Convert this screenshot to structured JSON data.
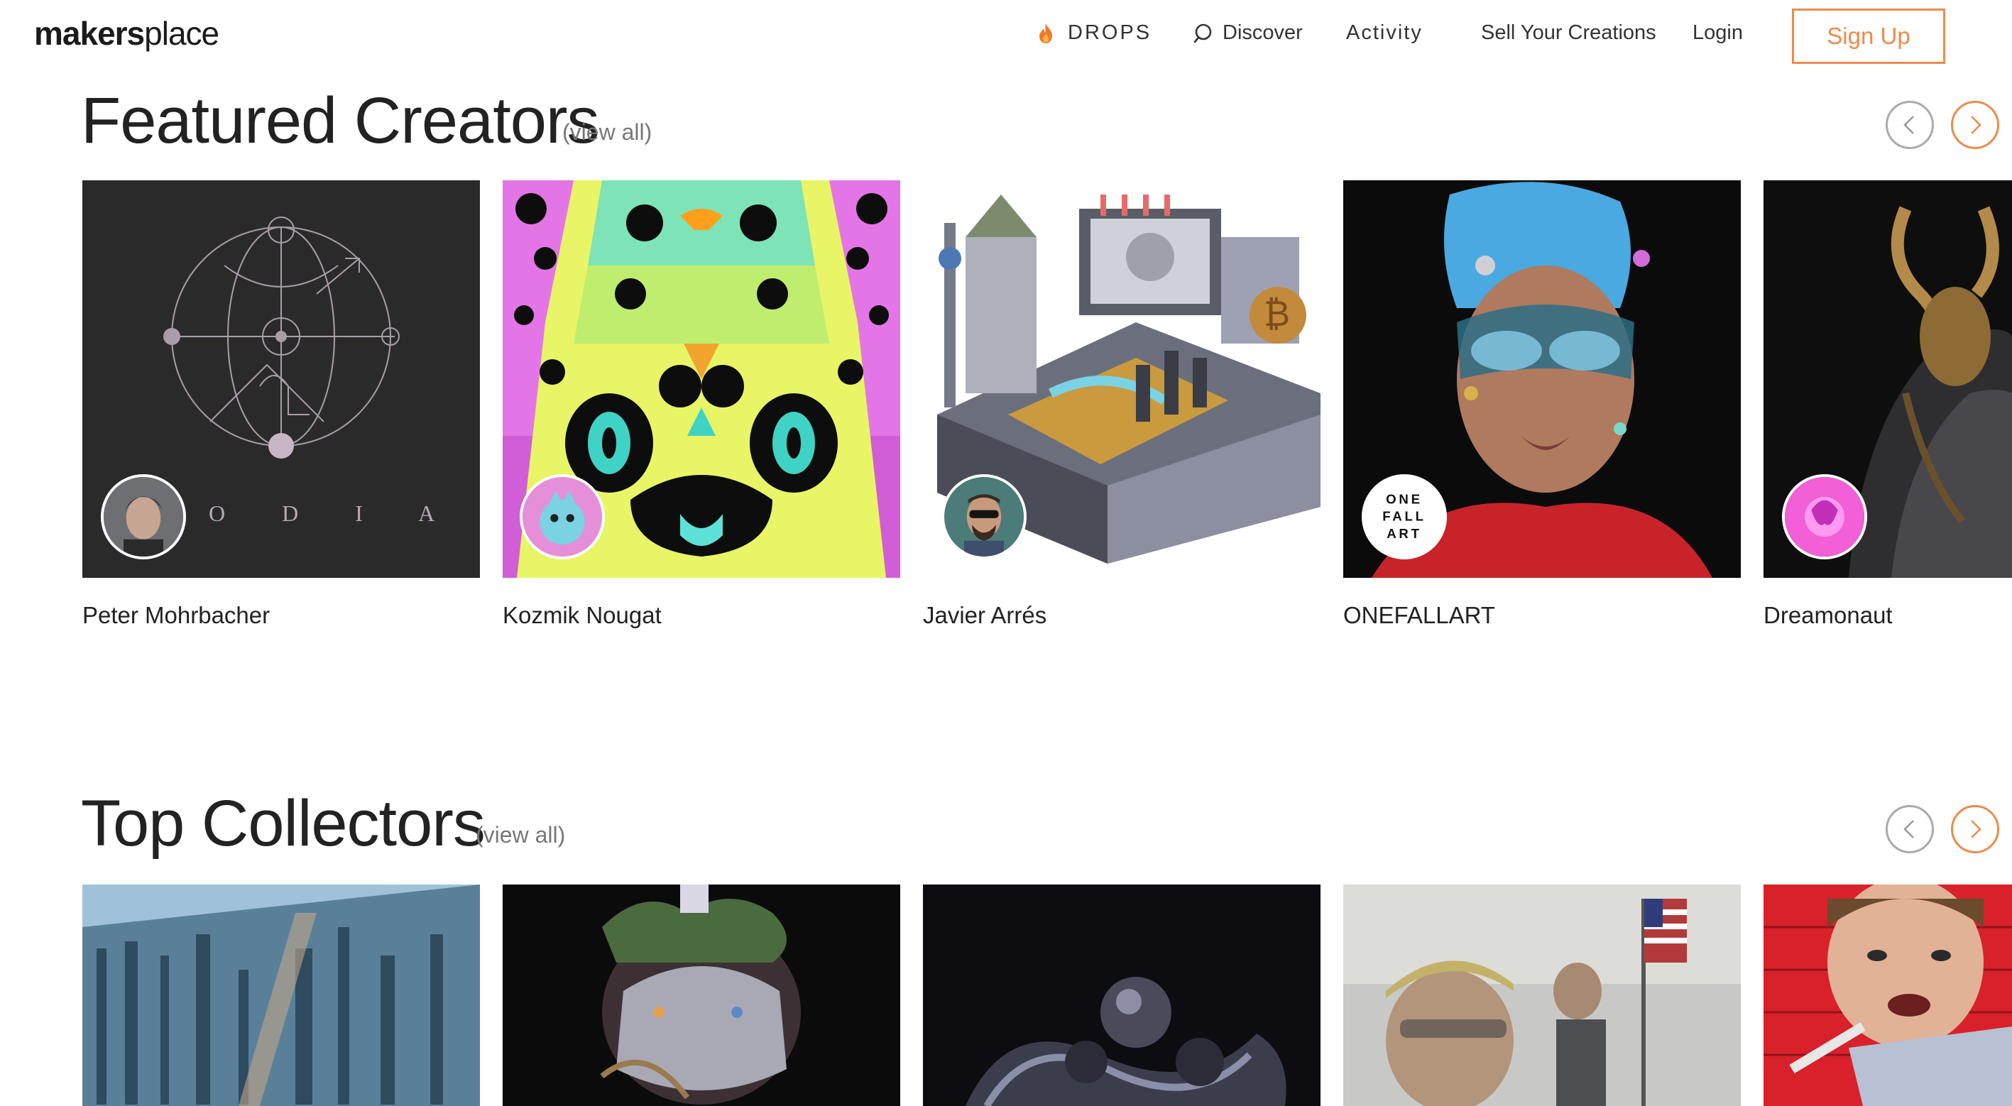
{
  "nav": {
    "logo_bold": "makers",
    "logo_light": "place",
    "drops": "DROPS",
    "discover": "Discover",
    "activity": "Activity",
    "sell": "Sell Your Creations",
    "login": "Login",
    "signup": "Sign Up"
  },
  "featured": {
    "title": "Featured Creators",
    "view_all": "(view all)",
    "creators": [
      {
        "name": "Peter Mohrbacher"
      },
      {
        "name": "Kozmik Nougat"
      },
      {
        "name": "Javier Arrés"
      },
      {
        "name": "ONEFALLART",
        "avatar_text": "ONE FALL ART"
      },
      {
        "name": "Dreamonaut"
      }
    ],
    "zodiac_text": "O D I A C"
  },
  "collectors": {
    "title": "Top Collectors",
    "view_all": "(view all)"
  },
  "colors": {
    "accent": "#f08a4b",
    "text": "#222222",
    "muted": "#777777"
  }
}
